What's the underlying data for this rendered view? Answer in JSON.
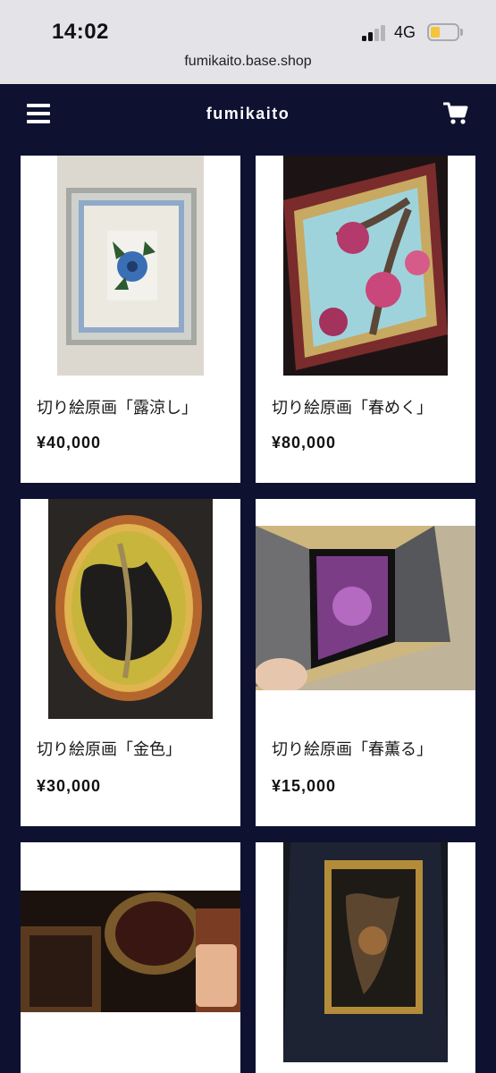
{
  "status_bar": {
    "time": "14:02",
    "network": "4G",
    "battery_color": "#f4c43a"
  },
  "browser": {
    "url": "fumikaito.base.shop"
  },
  "header": {
    "shop_name": "fumikaito",
    "menu_icon": "hamburger-menu-icon",
    "cart_icon": "shopping-cart-icon",
    "background": "#0e1230"
  },
  "products": [
    {
      "name": "切り絵原画「露涼し」",
      "price": "¥40,000"
    },
    {
      "name": "切り絵原画「春めく」",
      "price": "¥80,000"
    },
    {
      "name": "切り絵原画「金色」",
      "price": "¥30,000"
    },
    {
      "name": "切り絵原画「春薫る」",
      "price": "¥15,000"
    },
    {
      "name": "",
      "price": ""
    },
    {
      "name": "",
      "price": ""
    }
  ]
}
